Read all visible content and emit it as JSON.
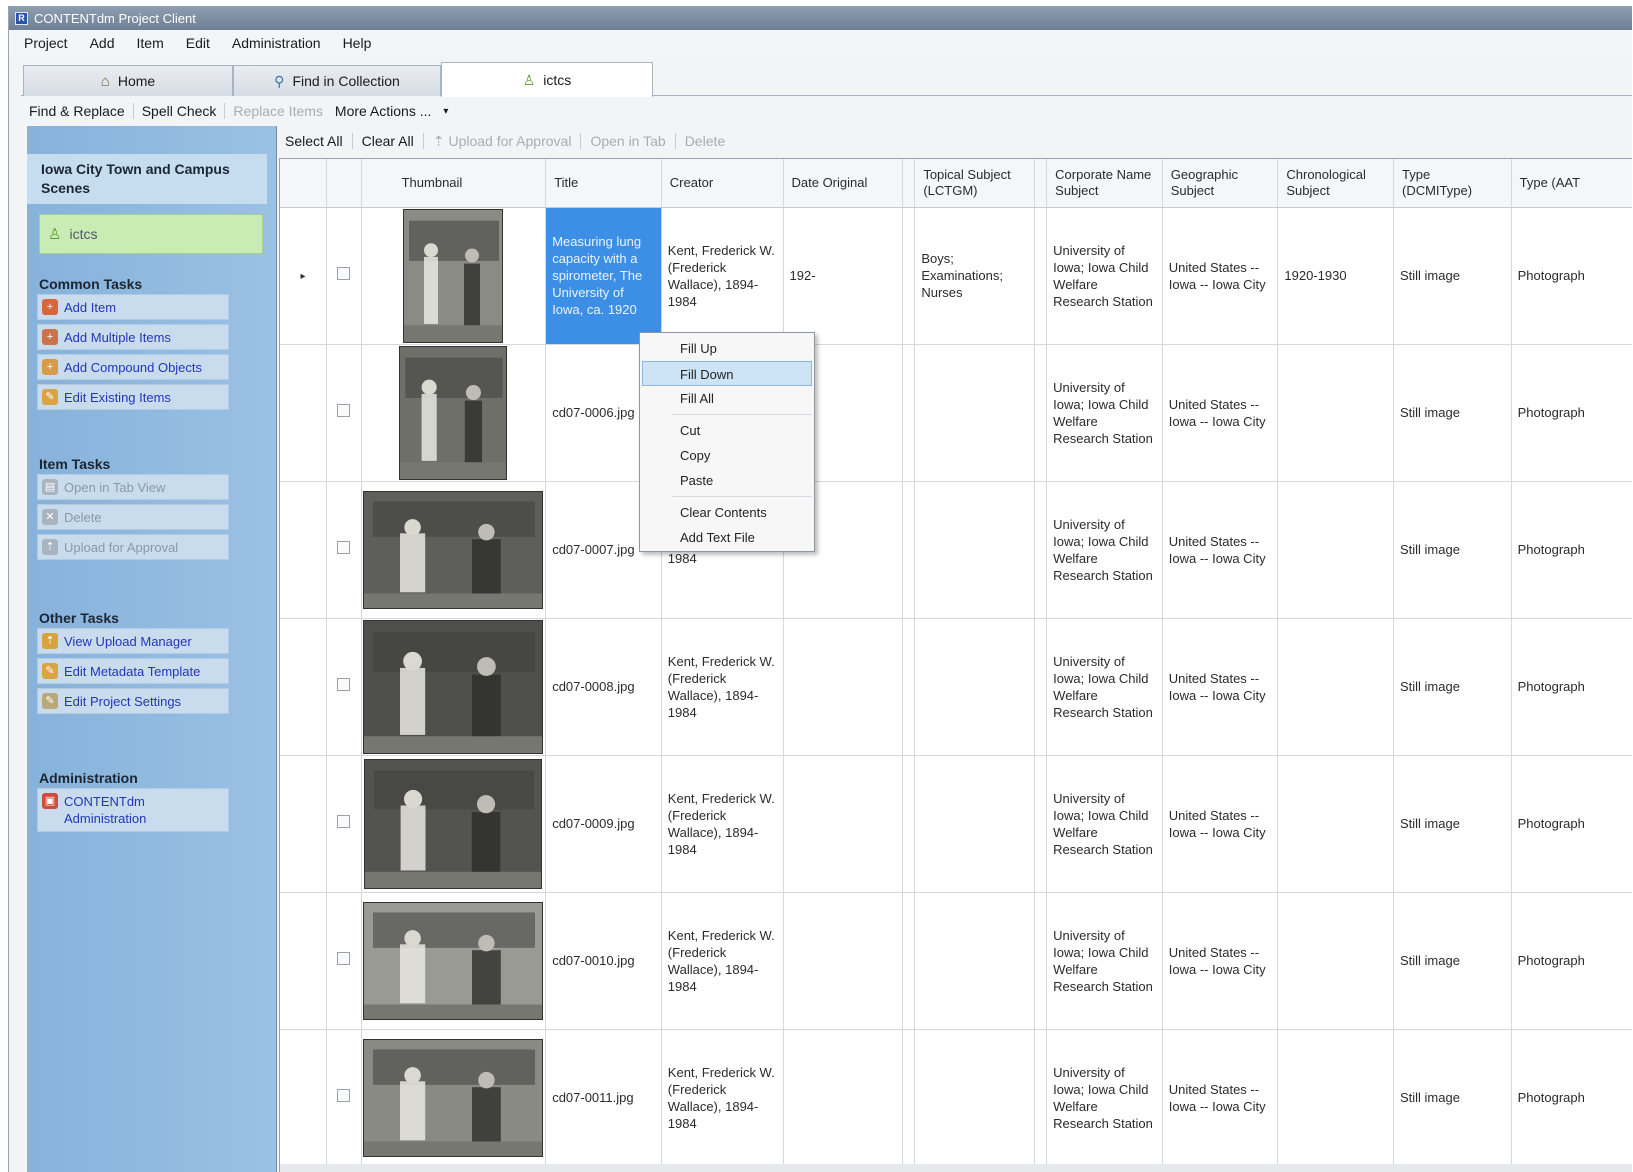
{
  "window": {
    "title": "CONTENTdm Project Client"
  },
  "menu": [
    "Project",
    "Add",
    "Item",
    "Edit",
    "Administration",
    "Help"
  ],
  "tabs": [
    {
      "label": "Home",
      "icon": "home-icon"
    },
    {
      "label": "Find in Collection",
      "icon": "search-icon"
    },
    {
      "label": "ictcs",
      "icon": "user-icon"
    }
  ],
  "toolbar1": {
    "find_replace": "Find & Replace",
    "spell_check": "Spell Check",
    "replace_items": "Replace Items",
    "more_actions": "More Actions ...",
    "more_arrow": "▾"
  },
  "toolbar2": {
    "select_all": "Select All",
    "clear_all": "Clear All",
    "upload": "Upload for Approval",
    "open_in_tab": "Open in Tab",
    "delete": "Delete"
  },
  "sidebar": {
    "collection_title": "Iowa City Town and Campus Scenes",
    "project_name": "ictcs",
    "common_tasks": {
      "heading": "Common Tasks",
      "items": [
        "Add Item",
        "Add Multiple Items",
        "Add Compound Objects",
        "Edit Existing Items"
      ]
    },
    "item_tasks": {
      "heading": "Item Tasks",
      "items": [
        "Open in Tab View",
        "Delete",
        "Upload for Approval"
      ]
    },
    "other_tasks": {
      "heading": "Other Tasks",
      "items": [
        "View Upload Manager",
        "Edit Metadata Template",
        "Edit Project Settings"
      ]
    },
    "administration": {
      "heading": "Administration",
      "items": [
        "CONTENTdm Administration"
      ]
    }
  },
  "grid": {
    "columns": [
      "",
      "",
      "Thumbnail",
      "Title",
      "Creator",
      "Date Original",
      "",
      "Topical Subject (LCTGM)",
      "",
      "Corporate Name Subject",
      "Geographic Subject",
      "Chronological Subject",
      "Type (DCMIType)",
      "Type (AAT"
    ],
    "rows": [
      {
        "indicator": "▸",
        "title": "Measuring lung capacity with a spirometer, The University of Iowa, ca. 1920",
        "creator": "Kent, Frederick W. (Frederick Wallace), 1894-1984",
        "date": "192-",
        "topical": "Boys; Examinations; Nurses",
        "corporate": "University of Iowa; Iowa Child Welfare Research Station",
        "geographic": "United States -- Iowa -- Iowa City",
        "chrono": "1920-1930",
        "dcmi": "Still image",
        "aat": "Photograph"
      },
      {
        "indicator": "",
        "title": "cd07-0006.jpg",
        "creator": "",
        "date": "",
        "topical": "",
        "corporate": "University of Iowa; Iowa Child Welfare Research Station",
        "geographic": "United States -- Iowa -- Iowa City",
        "chrono": "",
        "dcmi": "Still image",
        "aat": "Photograph"
      },
      {
        "indicator": "",
        "title": "cd07-0007.jpg",
        "creator": "Wallace), 1894-1984",
        "date": "",
        "topical": "",
        "corporate": "University of Iowa; Iowa Child Welfare Research Station",
        "geographic": "United States -- Iowa -- Iowa City",
        "chrono": "",
        "dcmi": "Still image",
        "aat": "Photograph"
      },
      {
        "indicator": "",
        "title": "cd07-0008.jpg",
        "creator": "Kent, Frederick W. (Frederick Wallace), 1894-1984",
        "date": "",
        "topical": "",
        "corporate": "University of Iowa; Iowa Child Welfare Research Station",
        "geographic": "United States -- Iowa -- Iowa City",
        "chrono": "",
        "dcmi": "Still image",
        "aat": "Photograph"
      },
      {
        "indicator": "",
        "title": "cd07-0009.jpg",
        "creator": "Kent, Frederick W. (Frederick Wallace), 1894-1984",
        "date": "",
        "topical": "",
        "corporate": "University of Iowa; Iowa Child Welfare Research Station",
        "geographic": "United States -- Iowa -- Iowa City",
        "chrono": "",
        "dcmi": "Still image",
        "aat": "Photograph"
      },
      {
        "indicator": "",
        "title": "cd07-0010.jpg",
        "creator": "Kent, Frederick W. (Frederick Wallace), 1894-1984",
        "date": "",
        "topical": "",
        "corporate": "University of Iowa; Iowa Child Welfare Research Station",
        "geographic": "United States -- Iowa -- Iowa City",
        "chrono": "",
        "dcmi": "Still image",
        "aat": "Photograph"
      },
      {
        "indicator": "",
        "title": "cd07-0011.jpg",
        "creator": "Kent, Frederick W. (Frederick Wallace), 1894-1984",
        "date": "",
        "topical": "",
        "corporate": "University of Iowa; Iowa Child Welfare Research Station",
        "geographic": "United States -- Iowa -- Iowa City",
        "chrono": "",
        "dcmi": "Still image",
        "aat": "Photograph"
      }
    ]
  },
  "context_menu": {
    "groups": [
      [
        "Fill Up",
        "Fill Down",
        "Fill All"
      ],
      [
        "Cut",
        "Copy",
        "Paste"
      ],
      [
        "Clear Contents",
        "Add Text File"
      ]
    ],
    "highlighted": "Fill Down"
  },
  "colors": {
    "sidebar": "#8fb8df",
    "selection": "#3d8fe6",
    "menu_highlight": "#cde4f7",
    "project_green": "#c8ecb4"
  }
}
